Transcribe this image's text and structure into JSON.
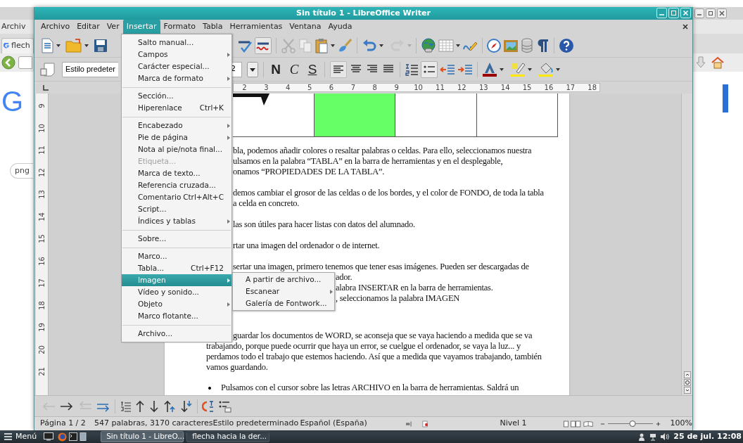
{
  "background_browser": {
    "menu_label": "Archiv",
    "tab_label": "flech",
    "logo_text": "G",
    "chip_label": "png"
  },
  "window": {
    "title": "Sin título 1 - LibreOffice Writer"
  },
  "menubar": [
    {
      "label": "Archivo",
      "selected": false
    },
    {
      "label": "Editar",
      "selected": false
    },
    {
      "label": "Ver",
      "selected": false
    },
    {
      "label": "Insertar",
      "selected": true
    },
    {
      "label": "Formato",
      "selected": false
    },
    {
      "label": "Tabla",
      "selected": false
    },
    {
      "label": "Herramientas",
      "selected": false
    },
    {
      "label": "Ventana",
      "selected": false
    },
    {
      "label": "Ayuda",
      "selected": false
    }
  ],
  "formatting_bar": {
    "paragraph_style": "Estilo predeter",
    "font_size": "2",
    "style_buttons": [
      "N",
      "C",
      "S"
    ],
    "bullets_active": true
  },
  "ruler": [
    "2",
    "3",
    "4",
    "5",
    "6",
    "7",
    "8",
    "9",
    "10",
    "11",
    "12",
    "13",
    "14",
    "15",
    "16",
    "17",
    "18"
  ],
  "vertical_ruler": [
    "9",
    "10",
    "11",
    "12",
    "13",
    "14",
    "15",
    "16",
    "17",
    "18",
    "19",
    "20",
    "21"
  ],
  "table_cells": [
    {
      "color": "#ffffff"
    },
    {
      "color": "#66ff66"
    },
    {
      "color": "#ffffff"
    },
    {
      "color": "#ffffff"
    }
  ],
  "paragraphs": [
    {
      "kind": "plain",
      "lines": [
        {
          "kind": "after_menu",
          "text": "bla, podemos añadir colores o resaltar palabras o celdas. Para ello, seleccionamos nuestra"
        },
        {
          "kind": "after_menu",
          "text": "ulsamos en la palabra “TABLA” en la barra de herramientas y en el desplegable,"
        },
        {
          "kind": "after_menu",
          "text": "onamos “PROPIEDADES DE LA TABLA”."
        }
      ]
    },
    {
      "kind": "plain",
      "lines": [
        {
          "kind": "after_menu",
          "text": "demos cambiar el grosor de las celdas o de los bordes, y el color de FONDO, de toda la tabla"
        },
        {
          "kind": "after_menu",
          "text": "a celda en concreto."
        }
      ]
    },
    {
      "kind": "plain",
      "lines": [
        {
          "kind": "after_menu",
          "text": "las son útiles para hacer listas con datos del alumnado."
        }
      ]
    },
    {
      "kind": "plain",
      "lines": [
        {
          "kind": "after_menu",
          "text": "rtar una imagen del ordenador o de internet."
        }
      ]
    },
    {
      "kind": "plain",
      "lines": [
        {
          "kind": "after_menu",
          "text": "sertar una imagen, primero tenemos que tener esas imágenes. Pueden ser descargadas de"
        },
        {
          "kind": "after_submenu",
          "text": "ador."
        },
        {
          "kind": "after_submenu",
          "text": "alabra INSERTAR en la barra de herramientas."
        },
        {
          "kind": "after_submenu",
          "text": ", seleccionamos la palabra IMAGEN"
        }
      ]
    },
    {
      "kind": "section_start",
      "lines": [
        {
          "kind": "after_menu",
          "text": "guardar los documentos de WORD, se aconseja que se vaya haciendo a medida que se va"
        },
        {
          "kind": "full",
          "text": "trabajando, porque puede ocurrir que haya un error, se cuelgue el ordenador, se vaya la luz... y"
        },
        {
          "kind": "full",
          "text": "perdamos todo el trabajo que estemos haciendo. Así que a medida que vayamos trabajando, también"
        },
        {
          "kind": "full",
          "text": "vamos guardando."
        }
      ]
    },
    {
      "kind": "bullet",
      "lines": [
        {
          "kind": "full",
          "text": "Pulsamos con el cursor sobre las letras ARCHIVO en la barra de herramientas. Saldrá un"
        }
      ]
    }
  ],
  "insert_menu": [
    {
      "kind": "item",
      "label": "Salto manual...",
      "submenu": false,
      "disabled": false,
      "selected": false
    },
    {
      "kind": "item",
      "label": "Campos",
      "submenu": true,
      "disabled": false,
      "selected": false
    },
    {
      "kind": "item",
      "label": "Carácter especial...",
      "submenu": false,
      "disabled": false,
      "selected": false
    },
    {
      "kind": "item",
      "label": "Marca de formato",
      "submenu": true,
      "disabled": false,
      "selected": false
    },
    {
      "kind": "separator"
    },
    {
      "kind": "item",
      "label": "Sección...",
      "submenu": false,
      "disabled": false,
      "selected": false
    },
    {
      "kind": "item",
      "label": "Hiperenlace",
      "shortcut": "Ctrl+K",
      "submenu": false,
      "disabled": false,
      "selected": false
    },
    {
      "kind": "separator"
    },
    {
      "kind": "item",
      "label": "Encabezado",
      "submenu": true,
      "disabled": false,
      "selected": false
    },
    {
      "kind": "item",
      "label": "Pie de página",
      "submenu": true,
      "disabled": false,
      "selected": false
    },
    {
      "kind": "item",
      "label": "Nota al pie/nota final...",
      "submenu": false,
      "disabled": false,
      "selected": false
    },
    {
      "kind": "item",
      "label": "Etiqueta...",
      "submenu": false,
      "disabled": true,
      "selected": false
    },
    {
      "kind": "item",
      "label": "Marca de texto...",
      "submenu": false,
      "disabled": false,
      "selected": false
    },
    {
      "kind": "item",
      "label": "Referencia cruzada...",
      "submenu": false,
      "disabled": false,
      "selected": false
    },
    {
      "kind": "item",
      "label": "Comentario",
      "shortcut": "Ctrl+Alt+C",
      "submenu": false,
      "disabled": false,
      "selected": false
    },
    {
      "kind": "item",
      "label": "Script...",
      "submenu": false,
      "disabled": false,
      "selected": false
    },
    {
      "kind": "item",
      "label": "Índices y tablas",
      "submenu": true,
      "disabled": false,
      "selected": false
    },
    {
      "kind": "separator"
    },
    {
      "kind": "item",
      "label": "Sobre...",
      "submenu": false,
      "disabled": false,
      "selected": false
    },
    {
      "kind": "separator"
    },
    {
      "kind": "item",
      "label": "Marco...",
      "submenu": false,
      "disabled": false,
      "selected": false
    },
    {
      "kind": "item",
      "label": "Tabla...",
      "shortcut": "Ctrl+F12",
      "submenu": false,
      "disabled": false,
      "selected": false
    },
    {
      "kind": "item",
      "label": "Imagen",
      "submenu": true,
      "disabled": false,
      "selected": true
    },
    {
      "kind": "item",
      "label": "Vídeo y sonido...",
      "submenu": false,
      "disabled": false,
      "selected": false
    },
    {
      "kind": "item",
      "label": "Objeto",
      "submenu": true,
      "disabled": false,
      "selected": false
    },
    {
      "kind": "item",
      "label": "Marco flotante...",
      "submenu": false,
      "disabled": false,
      "selected": false
    },
    {
      "kind": "separator"
    },
    {
      "kind": "item",
      "label": "Archivo...",
      "submenu": false,
      "disabled": false,
      "selected": false
    }
  ],
  "image_submenu": [
    {
      "label": "A partir de archivo...",
      "submenu": false
    },
    {
      "label": "Escanear",
      "submenu": true
    },
    {
      "label": "Galería de Fontwork...",
      "submenu": false
    }
  ],
  "status_bar": {
    "page": "Página 1 / 2",
    "words": "547 palabras, 3170 caracteres",
    "page_style": "Estilo predeterminado",
    "language": "Español (España)",
    "outline_level": "Nivel 1",
    "zoom": {
      "level": 0.55,
      "reading": "100%"
    }
  },
  "taskbar": {
    "menu_label": "Menú",
    "tasks": [
      {
        "label": "Sin título 1 - LibreO...",
        "selected": true
      },
      {
        "label": "flecha hacia la der...",
        "selected": false
      }
    ],
    "clock": "25 de jul. 12:08"
  }
}
